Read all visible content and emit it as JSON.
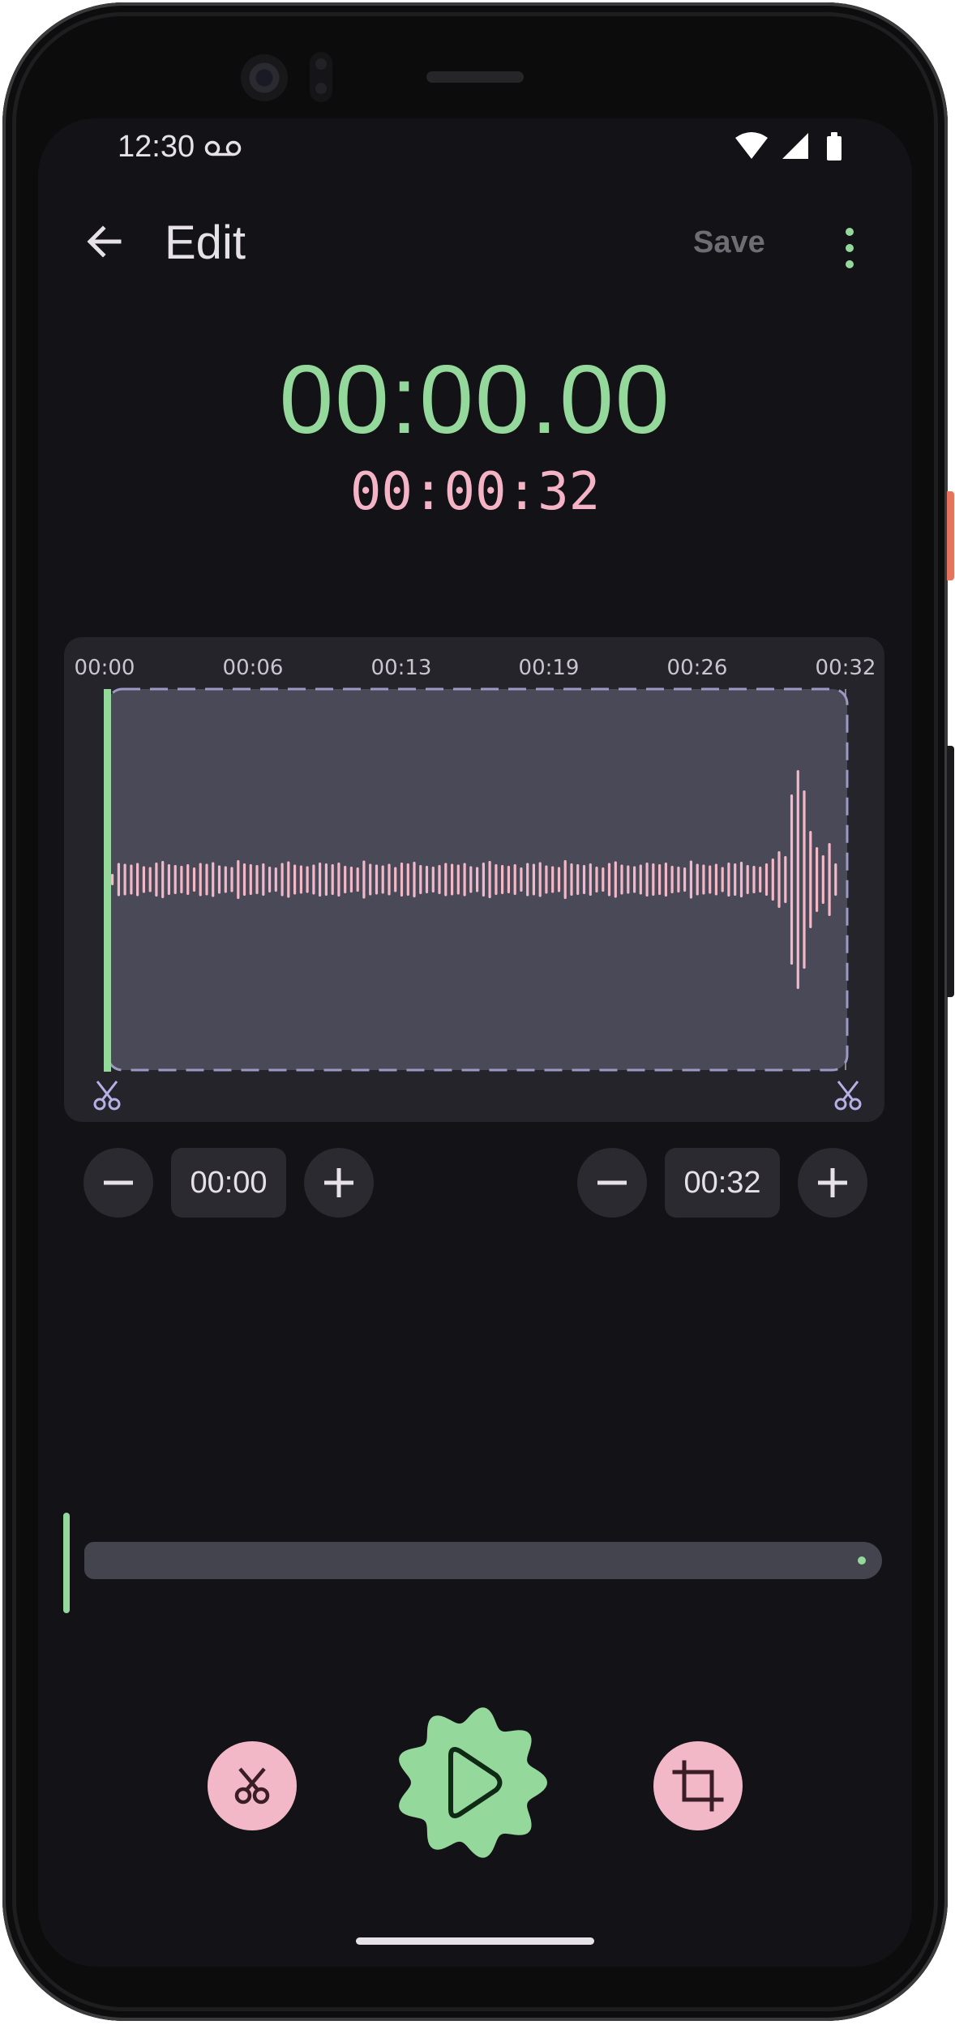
{
  "status_bar": {
    "time": "12:30",
    "icons": [
      "voicemail-icon",
      "wifi-icon",
      "signal-icon",
      "battery-icon"
    ]
  },
  "app_bar": {
    "title": "Edit",
    "save_label": "Save",
    "back_icon": "arrow-back-icon",
    "menu_icon": "more-vert-icon"
  },
  "timers": {
    "current": "00:00.00",
    "total": "00:00:32"
  },
  "waveform": {
    "tick_labels": [
      "00:00",
      "00:06",
      "00:13",
      "00:19",
      "00:26",
      "00:32"
    ],
    "selection_start_icon": "scissors-icon",
    "selection_end_icon": "scissors-icon"
  },
  "trim": {
    "start": {
      "value": "00:00",
      "minus_icon": "minus-icon",
      "plus_icon": "plus-icon"
    },
    "end": {
      "value": "00:32",
      "minus_icon": "minus-icon",
      "plus_icon": "plus-icon"
    }
  },
  "seek": {
    "progress": 0.0
  },
  "actions": {
    "cut_icon": "scissors-icon",
    "play_icon": "play-icon",
    "crop_icon": "crop-icon"
  },
  "colors": {
    "accent_green": "#94d89b",
    "accent_pink": "#f5b3c6",
    "background": "#131317",
    "selection_fill": "#4a4958",
    "selection_border": "#9d98c4"
  }
}
